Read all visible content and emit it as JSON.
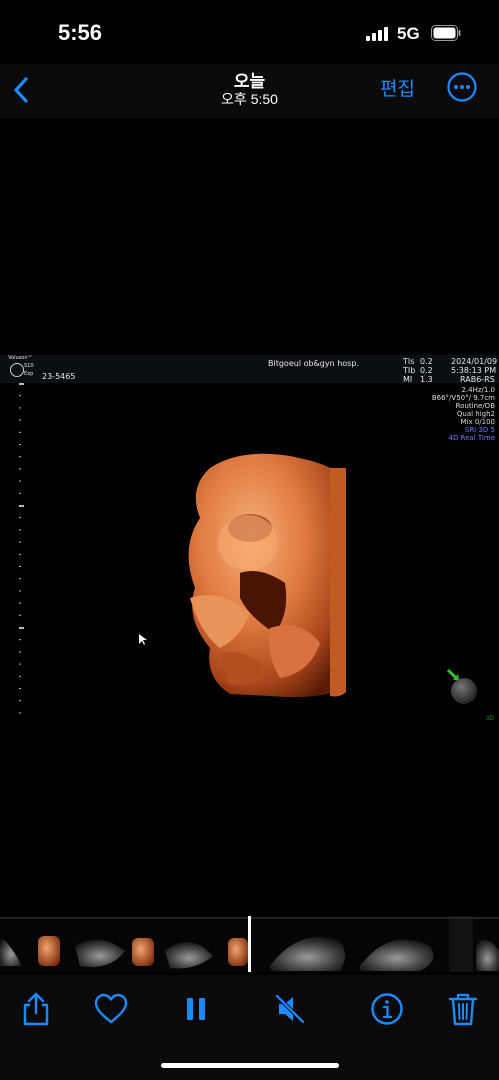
{
  "status_bar": {
    "time": "5:56",
    "network": "5G"
  },
  "nav": {
    "title": "오늘",
    "subtitle": "오후 5:50",
    "edit_label": "편집"
  },
  "ultrasound": {
    "brand": "Voluson™",
    "model": "S10",
    "model_sub": "Exp",
    "patient_id": "23-5465",
    "hospital": "Bitgoeul ob&gyn hosp.",
    "tis_label": "TIs",
    "tis_value": "0.2",
    "tib_label": "TIb",
    "tib_value": "0.2",
    "mi_label": "MI",
    "mi_value": "1.3",
    "date": "2024/01/09",
    "clock": "5:38:13 PM",
    "probe": "RAB6-RS",
    "params": [
      "2.4Hz/1.0",
      "B66°/V50°/ 9.7cm",
      "Routine/OB",
      "Qual high2",
      "Mix 0/100"
    ],
    "mode_lines": [
      "SRI 3D 5",
      "4D Real Time"
    ],
    "tag": "3D"
  },
  "colors": {
    "accent": "#1a8cff",
    "skin_light": "#f2a06a",
    "skin_dark": "#7a2a0a"
  },
  "icons": [
    "back-chevron-icon",
    "more-icon",
    "share-icon",
    "heart-icon",
    "pause-icon",
    "mute-icon",
    "info-icon",
    "trash-icon"
  ]
}
